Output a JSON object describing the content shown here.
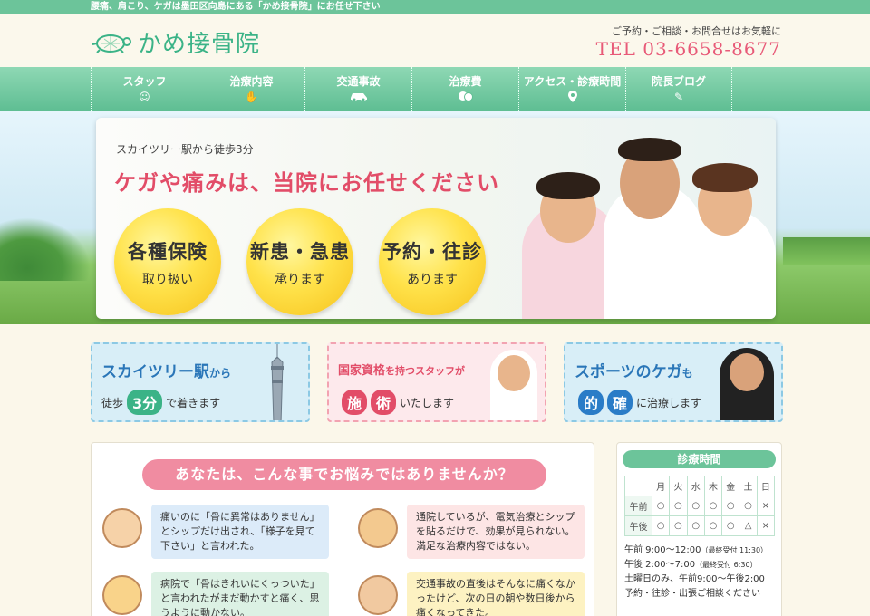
{
  "tagline": "腰痛、肩こり、ケガは墨田区向島にある「かめ接骨院」にお任せ下さい",
  "header": {
    "logo_text": "かめ接骨院",
    "contact_note": "ご予約・ご相談・お問合せはお気軽に",
    "tel": "TEL 03-6658-8677"
  },
  "nav": [
    {
      "label": "スタッフ",
      "icon": "smiley-icon"
    },
    {
      "label": "治療内容",
      "icon": "hand-icon"
    },
    {
      "label": "交通事故",
      "icon": "car-icon"
    },
    {
      "label": "治療費",
      "icon": "coins-icon"
    },
    {
      "label": "アクセス・診療時間",
      "icon": "map-pin-icon"
    },
    {
      "label": "院長ブログ",
      "icon": "pencil-icon"
    }
  ],
  "hero": {
    "sub": "スカイツリー駅から徒歩3分",
    "title": "ケガや痛みは、当院にお任せください",
    "badges": [
      {
        "line1": "各種保険",
        "line2": "取り扱い"
      },
      {
        "line1": "新患・急患",
        "line2": "承ります"
      },
      {
        "line1": "予約・往診",
        "line2": "あります"
      }
    ]
  },
  "features": [
    {
      "title": "スカイツリー駅",
      "title_suffix": "から",
      "sub_pre": "徒歩",
      "pill": "3分",
      "sub_post": "で着きます"
    },
    {
      "title": "国家資格",
      "title_suffix": "を持つスタッフが",
      "pill1": "施",
      "pill2": "術",
      "sub_post": "いたします"
    },
    {
      "title": "スポーツのケガ",
      "title_suffix": "も",
      "pill1": "的",
      "pill2": "確",
      "sub_post": "に治療します"
    }
  ],
  "worries": {
    "heading": "あなたは、こんな事でお悩みではありませんか？",
    "items": [
      "痛いのに「骨に異常はありません」とシップだけ出され、「様子を見て下さい」と言われた。",
      "通院しているが、電気治療とシップを貼るだけで、効果が見られない。満足な治療内容ではない。",
      "病院で「骨はきれいにくっついた」と言われたがまだ動かすと痛く、思うように動かない。",
      "交通事故の直後はそんなに痛くなかったけど、次の日の朝や数日後から痛くなってきた。"
    ]
  },
  "schedule": {
    "title": "診療時間",
    "days": [
      "",
      "月",
      "火",
      "水",
      "木",
      "金",
      "土",
      "日"
    ],
    "rows": [
      [
        "午前",
        "○",
        "○",
        "○",
        "○",
        "○",
        "○",
        "×"
      ],
      [
        "午後",
        "○",
        "○",
        "○",
        "○",
        "○",
        "△",
        "×"
      ]
    ],
    "hours": [
      {
        "text": "午前 9:00～12:00",
        "note": "（最終受付 11:30）"
      },
      {
        "text": "午後 2:00～7:00",
        "note": "（最終受付 6:30）"
      },
      {
        "text": "土曜日のみ、午前9:00～午後2:00",
        "note": ""
      },
      {
        "text": "予約・往診・出張ご相談ください",
        "note": ""
      }
    ]
  }
}
